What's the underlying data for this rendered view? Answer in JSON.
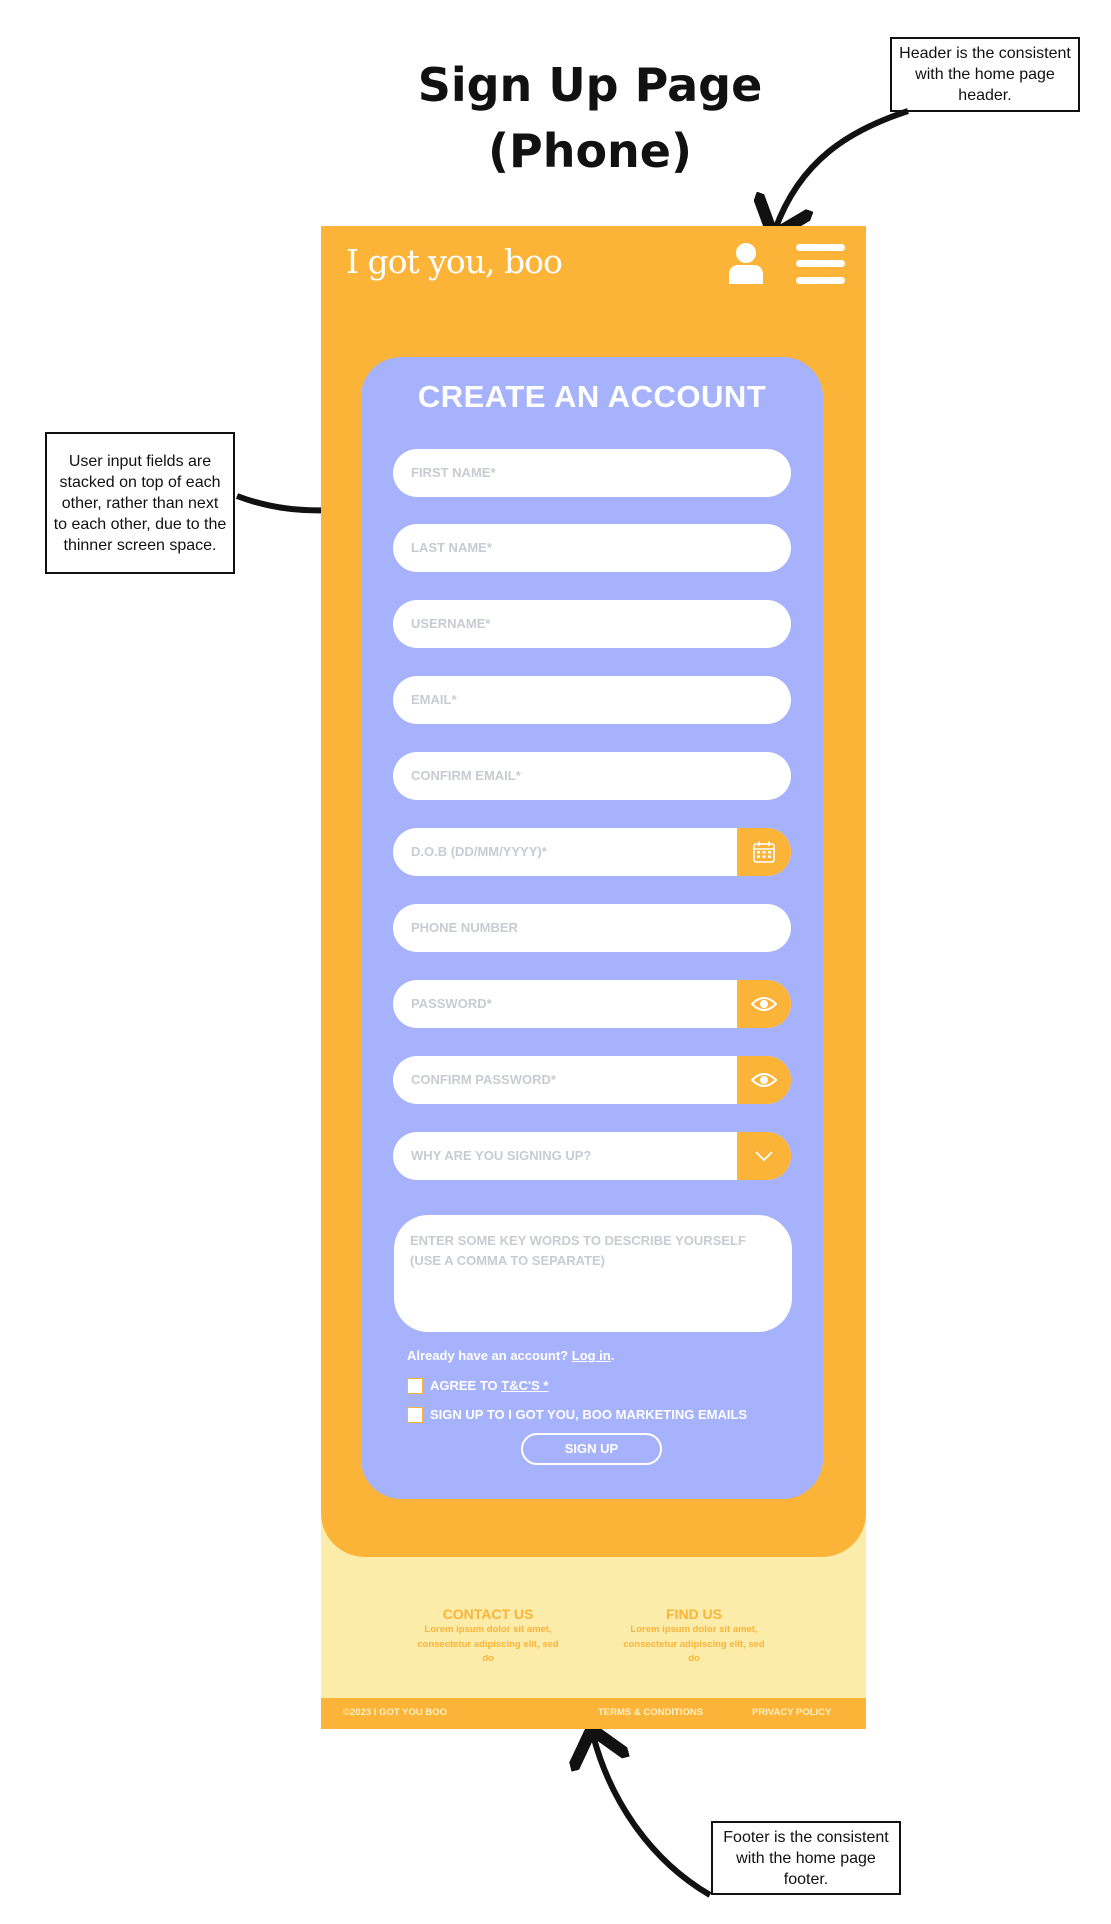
{
  "page_title": {
    "line1": "Sign Up Page",
    "line2": "(Phone)"
  },
  "annotations": {
    "header_note": "Header is the consistent with the home page header.",
    "fields_note": "User input fields are stacked on top of each other, rather than next to each other, due to the thinner screen space.",
    "footer_note": "Footer is the consistent with the home page footer."
  },
  "header": {
    "logo": "I got you, boo",
    "icons": [
      "user-icon",
      "menu-icon"
    ]
  },
  "form": {
    "title": "CREATE AN ACCOUNT",
    "fields": {
      "first_name": "FIRST NAME*",
      "last_name": "LAST NAME*",
      "username": "USERNAME*",
      "email": "EMAIL*",
      "confirm_email": "CONFIRM EMAIL*",
      "dob": "D.O.B (DD/MM/YYYY)*",
      "phone": "PHONE NUMBER",
      "password": "PASSWORD*",
      "confirm_password": "CONFIRM PASSWORD*",
      "reason": "WHY ARE YOU SIGNING UP?",
      "keywords": "ENTER SOME KEY WORDS TO DESCRIBE YOURSELF (USE A COMMA TO SEPARATE)"
    },
    "already_account": "Already have an account?",
    "login_link": "Log in",
    "login_period": ".",
    "agree_prefix": "AGREE TO ",
    "agree_link": "T&C'S *",
    "marketing": "SIGN UP TO I GOT YOU, BOO MARKETING EMAILS",
    "signup_button": "SIGN UP"
  },
  "footer": {
    "contact_title": "CONTACT US",
    "contact_body": "Lorem ipsum dolor sit amet, consectetur adipiscing elit, sed do",
    "find_title": "FIND US",
    "find_body": "Lorem ipsum dolor sit amet, consectetur adipiscing elit, sed do",
    "copyright": "©2023   I GOT YOU BOO",
    "terms": "TERMS & CONDITIONS",
    "privacy": "PRIVACY POLICY"
  },
  "colors": {
    "orange": "#fcb438",
    "periwinkle": "#a6b2fc",
    "cream": "#fcecaa",
    "placeholder": "#c9cbd2"
  }
}
